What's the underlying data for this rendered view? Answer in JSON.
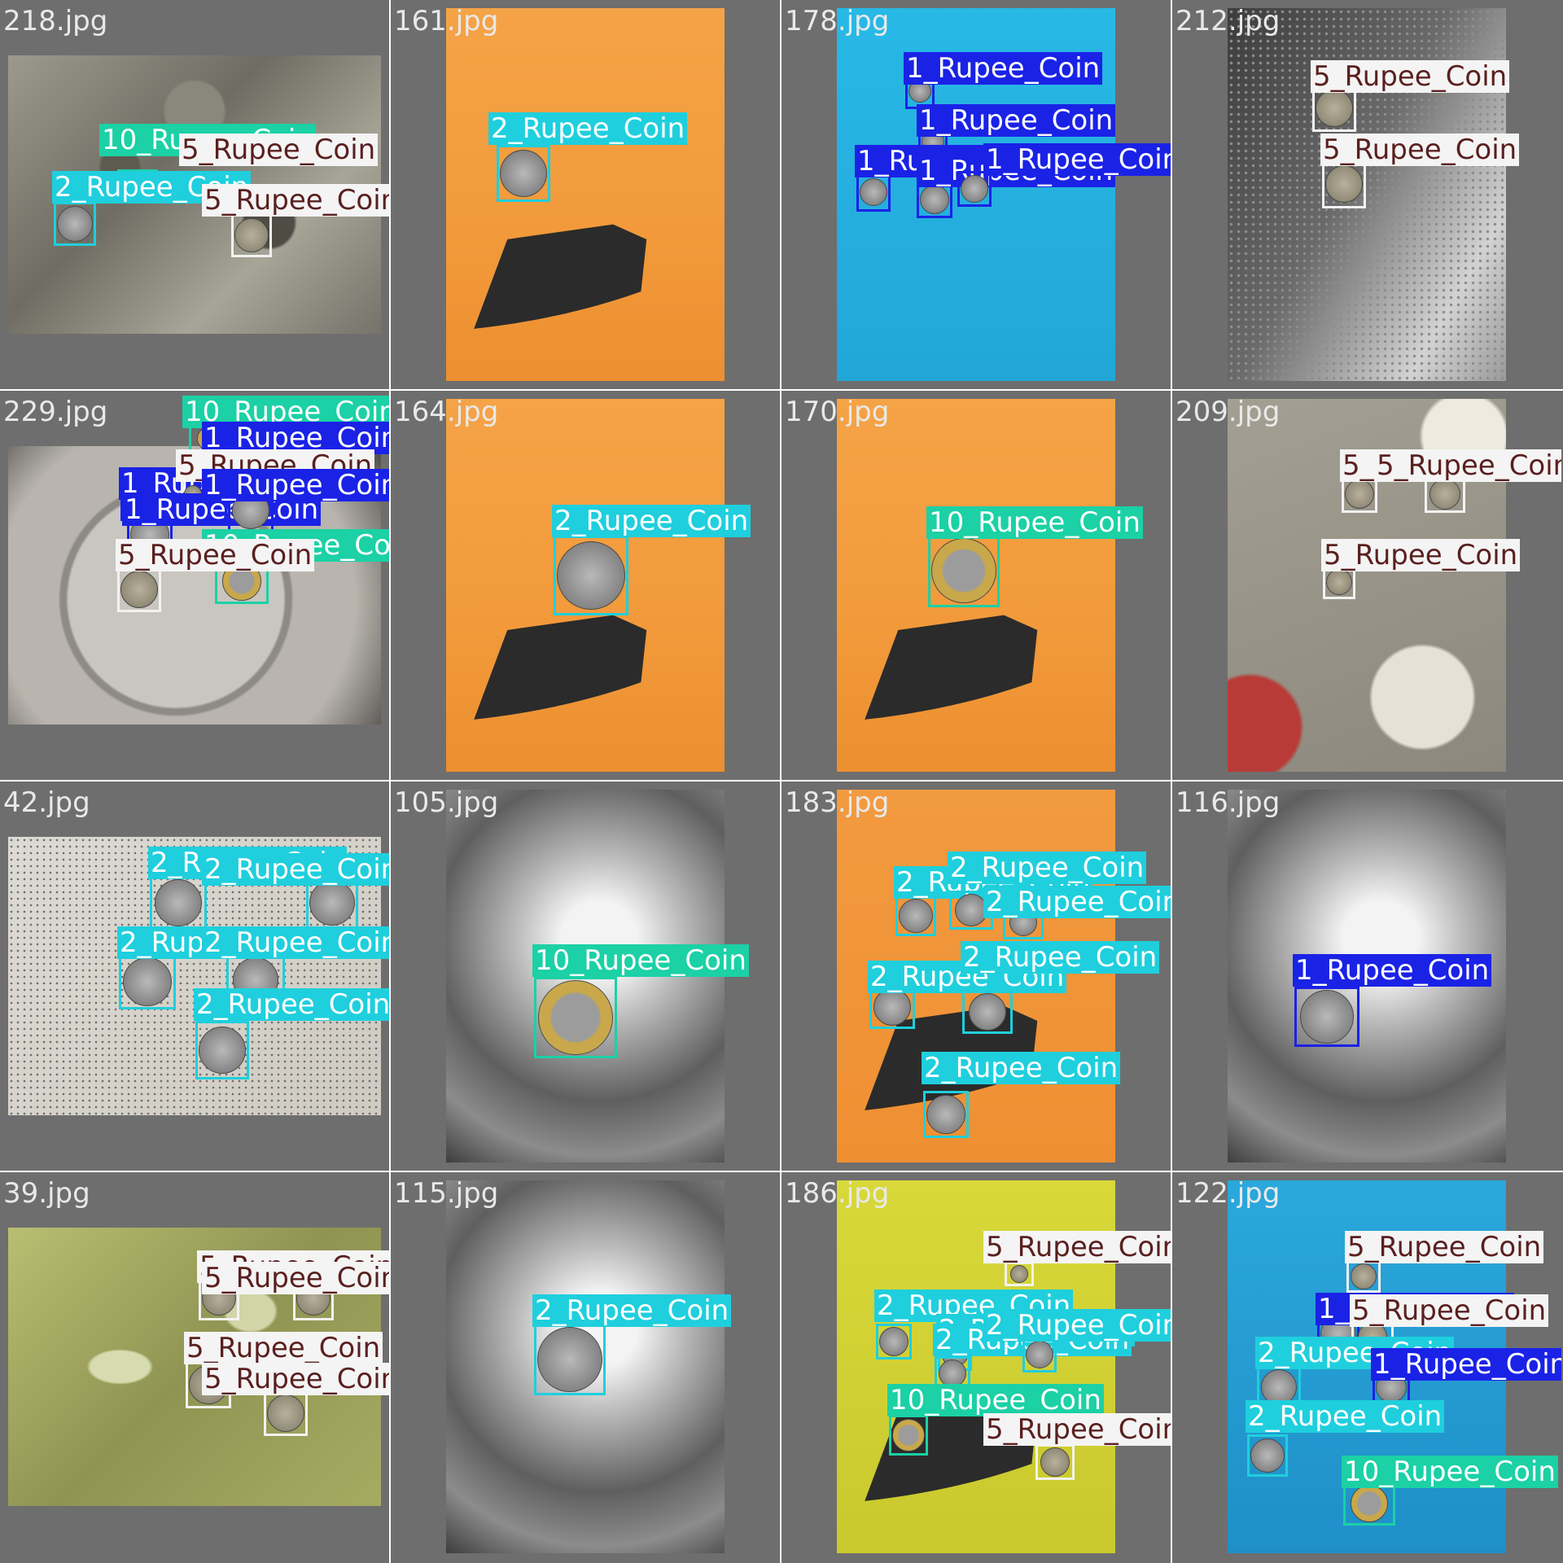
{
  "classes": {
    "1_Rupee_Coin": {
      "box": "#1a22e6",
      "bg": "#1a22e6",
      "fg": "#ffffff"
    },
    "2_Rupee_Coin": {
      "box": "#1fcfdd",
      "bg": "#1fcfdd",
      "fg": "#ffffff"
    },
    "5_Rupee_Coin": {
      "box": "#f2f2f2",
      "bg": "#f4f4f4",
      "fg": "#5a1f1f"
    },
    "10_Rupee_Coin": {
      "box": "#1bd1a5",
      "bg": "#1bd1a5",
      "fg": "#ffffff"
    }
  },
  "tiles": [
    {
      "name": "218.jpg",
      "scene": "granite",
      "detections": [
        {
          "cls": "10_Rupee_Coin",
          "label": "10_Rupee_Coin"
        },
        {
          "cls": "5_Rupee_Coin",
          "label": "5_Rupee_Coin"
        },
        {
          "cls": "2_Rupee_Coin",
          "label": "2_Rupee_Coin"
        },
        {
          "cls": "5_Rupee_Coin",
          "label": "5_Rupee_Coin"
        }
      ]
    },
    {
      "name": "161.jpg",
      "scene": "orange",
      "detections": [
        {
          "cls": "2_Rupee_Coin",
          "label": "2_Rupee_Coin"
        }
      ]
    },
    {
      "name": "178.jpg",
      "scene": "cyan",
      "detections": [
        {
          "cls": "1_Rupee_Coin",
          "label": "1_Rupee_Coin"
        },
        {
          "cls": "1_Rupee_Coin",
          "label": "1_Rupee_Coin"
        },
        {
          "cls": "1_Rupee_Coin",
          "label": "1_Rupee_Coin"
        },
        {
          "cls": "1_Rupee_Coin",
          "label": "1_Rupee_Coin"
        },
        {
          "cls": "1_Rupee_Coin",
          "label": "1_Rupee_Coin"
        }
      ]
    },
    {
      "name": "212.jpg",
      "scene": "darkdots",
      "detections": [
        {
          "cls": "5_Rupee_Coin",
          "label": "5_Rupee_Coin"
        },
        {
          "cls": "5_Rupee_Coin",
          "label": "5_Rupee_Coin"
        }
      ]
    },
    {
      "name": "229.jpg",
      "scene": "plate",
      "detections": [
        {
          "cls": "10_Rupee_Coin",
          "label": "10_Rupee_Coin"
        },
        {
          "cls": "1_Rupee_Coin",
          "label": "1_Rupee_Coin"
        },
        {
          "cls": "1_Rupee_Coin",
          "label": "1_Rupee_Coin"
        },
        {
          "cls": "5_Rupee_Coin",
          "label": "5_Rupee_Coin"
        },
        {
          "cls": "1_Rupee_Coin",
          "label": "1_Rupee_Coin"
        },
        {
          "cls": "1_Rupee_Coin",
          "label": "1_Rupee_Coin"
        },
        {
          "cls": "10_Rupee_Coin",
          "label": "10_Rupee_Coin"
        },
        {
          "cls": "5_Rupee_Coin",
          "label": "5_Rupee_Coin"
        }
      ]
    },
    {
      "name": "164.jpg",
      "scene": "orange",
      "detections": [
        {
          "cls": "2_Rupee_Coin",
          "label": "2_Rupee_Coin"
        }
      ]
    },
    {
      "name": "170.jpg",
      "scene": "orange",
      "detections": [
        {
          "cls": "10_Rupee_Coin",
          "label": "10_Rupee_Coin"
        }
      ]
    },
    {
      "name": "209.jpg",
      "scene": "concrete",
      "detections": [
        {
          "cls": "5_Rupee_Coin",
          "label": "5_Rupee_Coin"
        },
        {
          "cls": "5_Rupee_Coin",
          "label": "5_Rupee_Coin"
        },
        {
          "cls": "5_Rupee_Coin",
          "label": "5_Rupee_Coin"
        }
      ]
    },
    {
      "name": "42.jpg",
      "scene": "paperdots",
      "detections": [
        {
          "cls": "2_Rupee_Coin",
          "label": "2_Rupee_Coin"
        },
        {
          "cls": "2_Rupee_Coin",
          "label": "2_Rupee_Coin"
        },
        {
          "cls": "2_Rupee_Coin",
          "label": "2_Rupee_Coin"
        },
        {
          "cls": "2_Rupee_Coin",
          "label": "2_Rupee_Coin"
        },
        {
          "cls": "2_Rupee_Coin",
          "label": "2_Rupee_Coin"
        }
      ]
    },
    {
      "name": "105.jpg",
      "scene": "steel",
      "detections": [
        {
          "cls": "10_Rupee_Coin",
          "label": "10_Rupee_Coin"
        }
      ]
    },
    {
      "name": "183.jpg",
      "scene": "orangenote",
      "detections": [
        {
          "cls": "2_Rupee_Coin",
          "label": "2_Rupee_Coin"
        },
        {
          "cls": "2_Rupee_Coin",
          "label": "2_Rupee_Coin"
        },
        {
          "cls": "2_Rupee_Coin",
          "label": "2_Rupee_Coin"
        },
        {
          "cls": "2_Rupee_Coin",
          "label": "2_Rupee_Coin"
        },
        {
          "cls": "2_Rupee_Coin",
          "label": "2_Rupee_Coin"
        },
        {
          "cls": "2_Rupee_Coin",
          "label": "2_Rupee_Coin"
        }
      ]
    },
    {
      "name": "116.jpg",
      "scene": "steel",
      "detections": [
        {
          "cls": "1_Rupee_Coin",
          "label": "1_Rupee_Coin"
        }
      ]
    },
    {
      "name": "39.jpg",
      "scene": "fabric",
      "detections": [
        {
          "cls": "5_Rupee_Coin",
          "label": "5_Rupee_Coin"
        },
        {
          "cls": "5_Rupee_Coin",
          "label": "5_Rupee_Coin"
        },
        {
          "cls": "5_Rupee_Coin",
          "label": "5_Rupee_Coin"
        },
        {
          "cls": "5_Rupee_Coin",
          "label": "5_Rupee_Coin"
        }
      ]
    },
    {
      "name": "115.jpg",
      "scene": "steel",
      "detections": [
        {
          "cls": "2_Rupee_Coin",
          "label": "2_Rupee_Coin"
        }
      ]
    },
    {
      "name": "186.jpg",
      "scene": "yellow",
      "detections": [
        {
          "cls": "5_Rupee_Coin",
          "label": "5_Rupee_Coin"
        },
        {
          "cls": "2_Rupee_Coin",
          "label": "2_Rupee_Coin"
        },
        {
          "cls": "2_Rupee_Coin",
          "label": "2_Rupee_Coin"
        },
        {
          "cls": "2_Rupee_Coin",
          "label": "2_Rupee_Coin"
        },
        {
          "cls": "2_Rupee_Coin",
          "label": "2_Rupee_Coin"
        },
        {
          "cls": "10_Rupee_Coin",
          "label": "10_Rupee_Coin"
        },
        {
          "cls": "5_Rupee_Coin",
          "label": "5_Rupee_Coin"
        }
      ]
    },
    {
      "name": "122.jpg",
      "scene": "bluenote",
      "detections": [
        {
          "cls": "5_Rupee_Coin",
          "label": "5_Rupee_Coin"
        },
        {
          "cls": "1_Rupee_Coin",
          "label": "1_Rupee_Coin"
        },
        {
          "cls": "5_Rupee_Coin",
          "label": "5_Rupee_Coin"
        },
        {
          "cls": "2_Rupee_Coin",
          "label": "2_Rupee_Coin"
        },
        {
          "cls": "1_Rupee_Coin",
          "label": "1_Rupee_Coin"
        },
        {
          "cls": "2_Rupee_Coin",
          "label": "2_Rupee_Coin"
        },
        {
          "cls": "10_Rupee_Coin",
          "label": "10_Rupee_Coin"
        }
      ]
    }
  ]
}
